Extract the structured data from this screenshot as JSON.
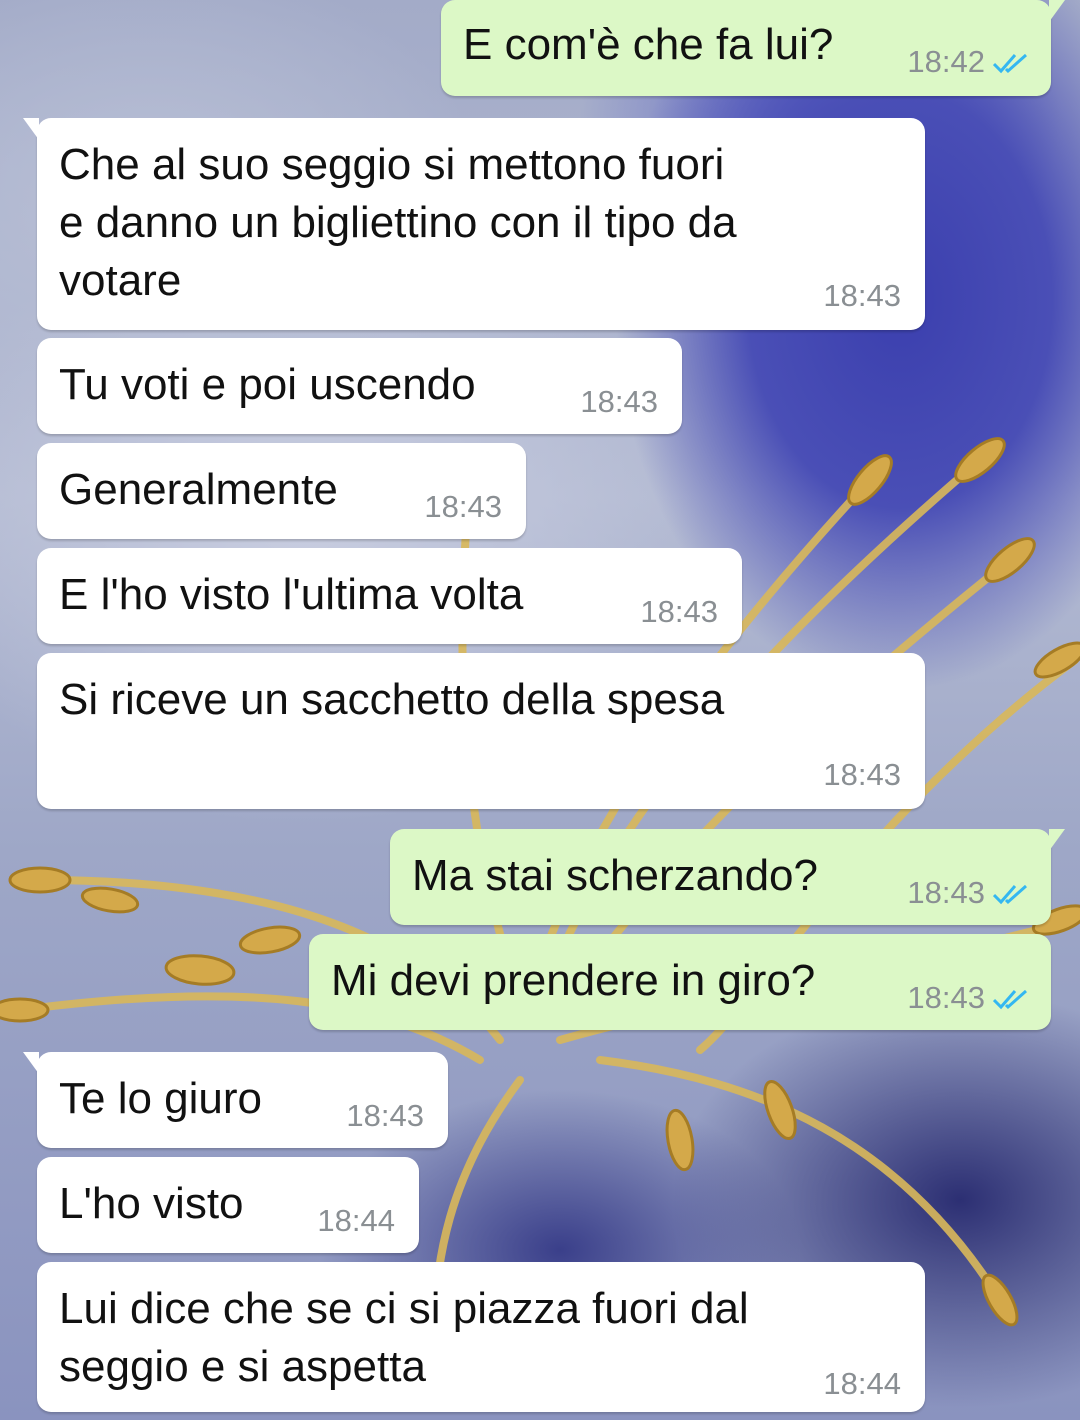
{
  "colors": {
    "incoming_bubble": "#ffffff",
    "outgoing_bubble": "#dcf8c6",
    "timestamp": "#8a8f93",
    "read_ticks": "#34b7f1"
  },
  "messages": [
    {
      "direction": "out",
      "text": "E com'è che fa lui?",
      "time": "18:42",
      "status_icon": "double-check-read"
    },
    {
      "direction": "in",
      "text": "Che al suo seggio si mettono fuori\ne danno un bigliettino con il tipo da\nvotare",
      "time": "18:43"
    },
    {
      "direction": "in",
      "text": "Tu voti e poi uscendo",
      "time": "18:43"
    },
    {
      "direction": "in",
      "text": "Generalmente",
      "time": "18:43"
    },
    {
      "direction": "in",
      "text": "E l'ho visto l'ultima volta",
      "time": "18:43"
    },
    {
      "direction": "in",
      "text": "Si riceve un sacchetto della spesa",
      "time": "18:43"
    },
    {
      "direction": "out",
      "text": "Ma stai scherzando?",
      "time": "18:43",
      "status_icon": "double-check-read"
    },
    {
      "direction": "out",
      "text": "Mi devi prendere in giro?",
      "time": "18:43",
      "status_icon": "double-check-read"
    },
    {
      "direction": "in",
      "text": "Te lo giuro",
      "time": "18:43"
    },
    {
      "direction": "in",
      "text": "L'ho visto",
      "time": "18:44"
    },
    {
      "direction": "in",
      "text": "Lui dice che se ci si piazza fuori dal\nseggio e si aspetta",
      "time": "18:44"
    }
  ]
}
